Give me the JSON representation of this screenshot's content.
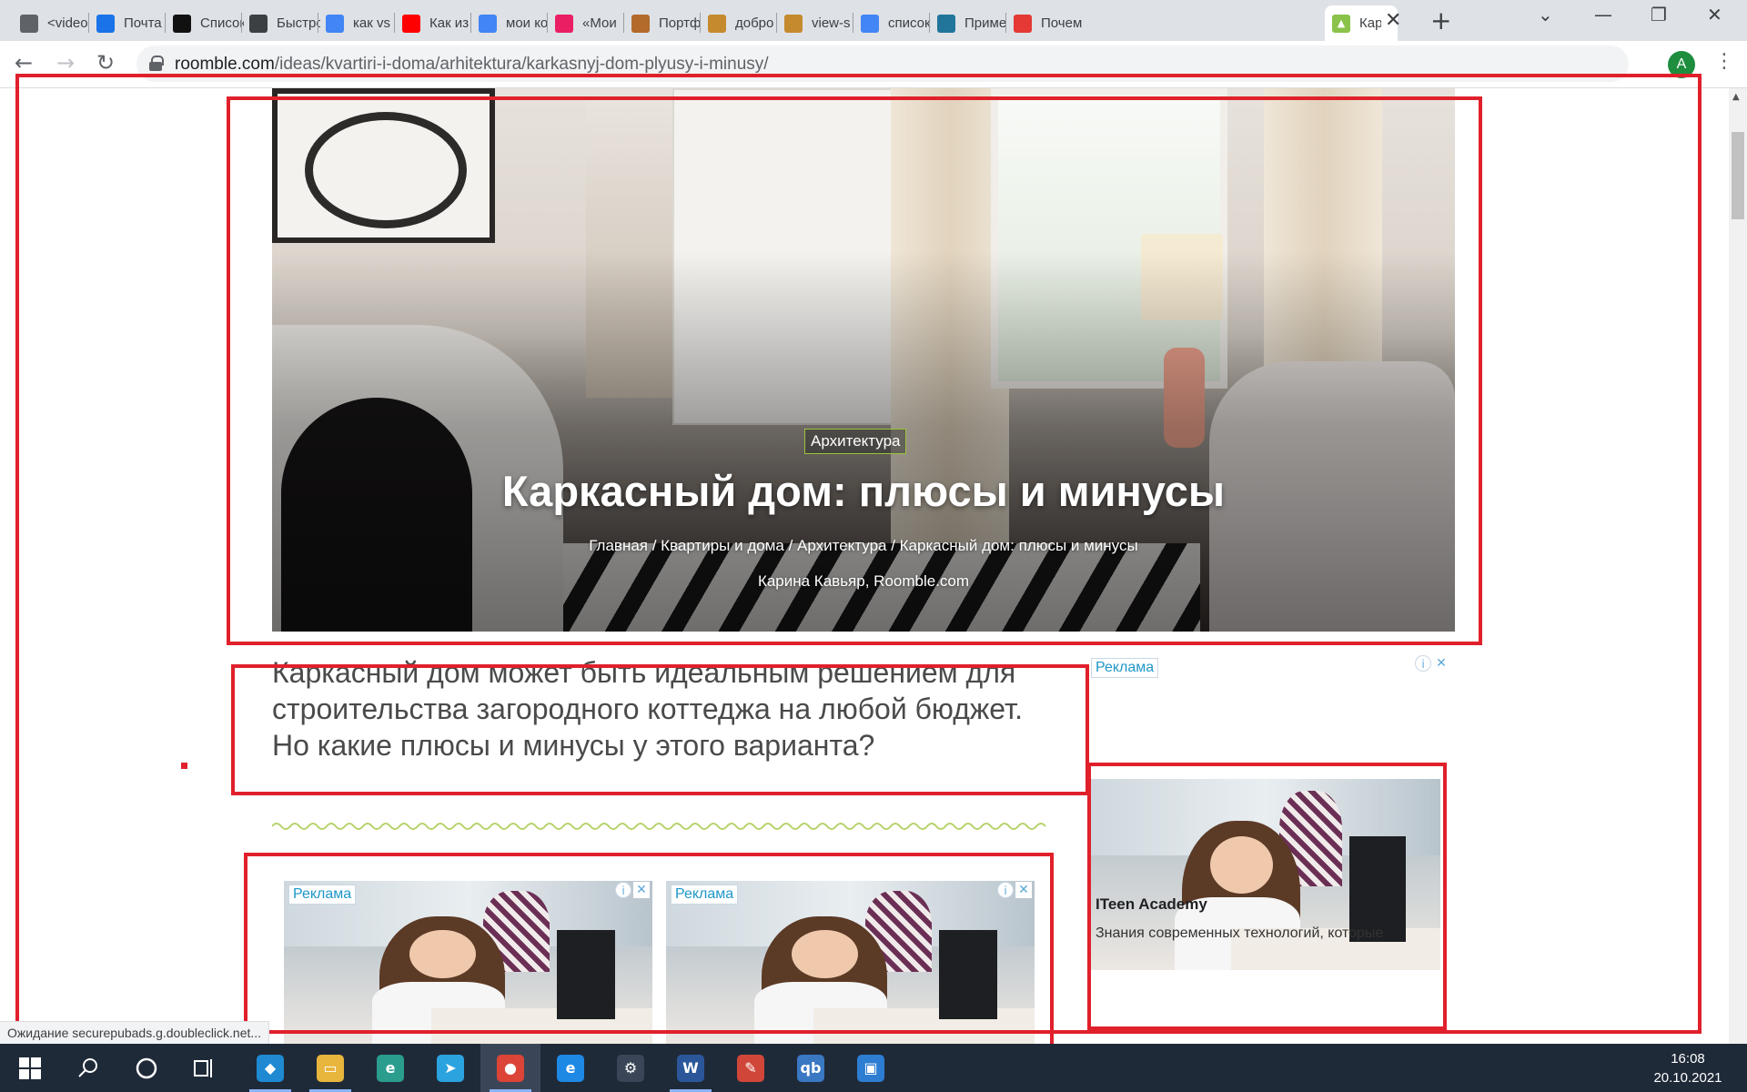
{
  "browser": {
    "tabs": [
      {
        "title": "<video",
        "icon": "chat-icon",
        "color": "#5f6368"
      },
      {
        "title": "Почта",
        "icon": "mail-icon",
        "color": "#1a73e8"
      },
      {
        "title": "Список",
        "icon": "ta-icon",
        "color": "#111111"
      },
      {
        "title": "Быстро",
        "icon": "chart-icon",
        "color": "#3c4043"
      },
      {
        "title": "как vs",
        "icon": "google-icon",
        "color": "#4285f4"
      },
      {
        "title": "Как из",
        "icon": "youtube-icon",
        "color": "#ff0000"
      },
      {
        "title": "мои ко",
        "icon": "google-icon",
        "color": "#4285f4"
      },
      {
        "title": "«Мои",
        "icon": "z-icon",
        "color": "#e91e63"
      },
      {
        "title": "Портф",
        "icon": "monkey-icon",
        "color": "#b26b2a"
      },
      {
        "title": "добро",
        "icon": "triangle-icon",
        "color": "#c58a2e"
      },
      {
        "title": "view-s",
        "icon": "triangle-icon",
        "color": "#c58a2e"
      },
      {
        "title": "список",
        "icon": "google-icon",
        "color": "#4285f4"
      },
      {
        "title": "Приме",
        "icon": "wordpress-icon",
        "color": "#21759b"
      },
      {
        "title": "Почем",
        "icon": "checker-icon",
        "color": "#e53935"
      }
    ],
    "active_tab": {
      "title": "Кар",
      "icon": "roomble-icon",
      "color": "#8bc34a"
    },
    "url_host": "roomble.com",
    "url_path": "/ideas/kvartiri-i-doma/arhitektura/karkasnyj-dom-plyusy-i-minusy/",
    "profile_initial": "A",
    "status_text": "Ожидание securepubads.g.doubleclick.net..."
  },
  "article": {
    "category": "Архитектура",
    "title": "Каркасный дом: плюсы и минусы",
    "breadcrumb": "Главная / Квартиры и дома / Архитектура / Каркасный дом: плюсы и минусы",
    "byline": "Карина Кавьяр, Roomble.com",
    "lead": "Каркасный дом может быть идеальным решением для строительства загородного коттеджа на любой бюджет. Но какие плюсы и минусы у этого варианта?"
  },
  "ads": {
    "label": "Реклама",
    "side_title": "ITeen Academy",
    "side_desc": "Знания современных технологий, которые"
  },
  "taskbar": {
    "apps": [
      {
        "icon": "vscode-icon",
        "color": "#1f8ad2",
        "glyph": "◆",
        "running": true
      },
      {
        "icon": "folder-icon",
        "color": "#e8b53d",
        "glyph": "▭",
        "running": true
      },
      {
        "icon": "edge-icon",
        "color": "#2a9d8f",
        "glyph": "e",
        "running": false
      },
      {
        "icon": "telegram-icon",
        "color": "#2aa3df",
        "glyph": "➤",
        "running": false
      },
      {
        "icon": "chrome-icon",
        "color": "#db4437",
        "glyph": "●",
        "running": true,
        "active": true
      },
      {
        "icon": "ie-icon",
        "color": "#1e88e5",
        "glyph": "e",
        "running": false
      },
      {
        "icon": "settings-icon",
        "color": "#3a4657",
        "glyph": "⚙",
        "running": false
      },
      {
        "icon": "word-icon",
        "color": "#2b579a",
        "glyph": "W",
        "running": true
      },
      {
        "icon": "paint-icon",
        "color": "#d0473a",
        "glyph": "✎",
        "running": false
      },
      {
        "icon": "qbittorrent-icon",
        "color": "#3a78c3",
        "glyph": "qb",
        "running": false
      },
      {
        "icon": "photos-icon",
        "color": "#2d7dd2",
        "glyph": "▣",
        "running": false
      }
    ],
    "time": "16:08",
    "date": "20.10.2021"
  }
}
